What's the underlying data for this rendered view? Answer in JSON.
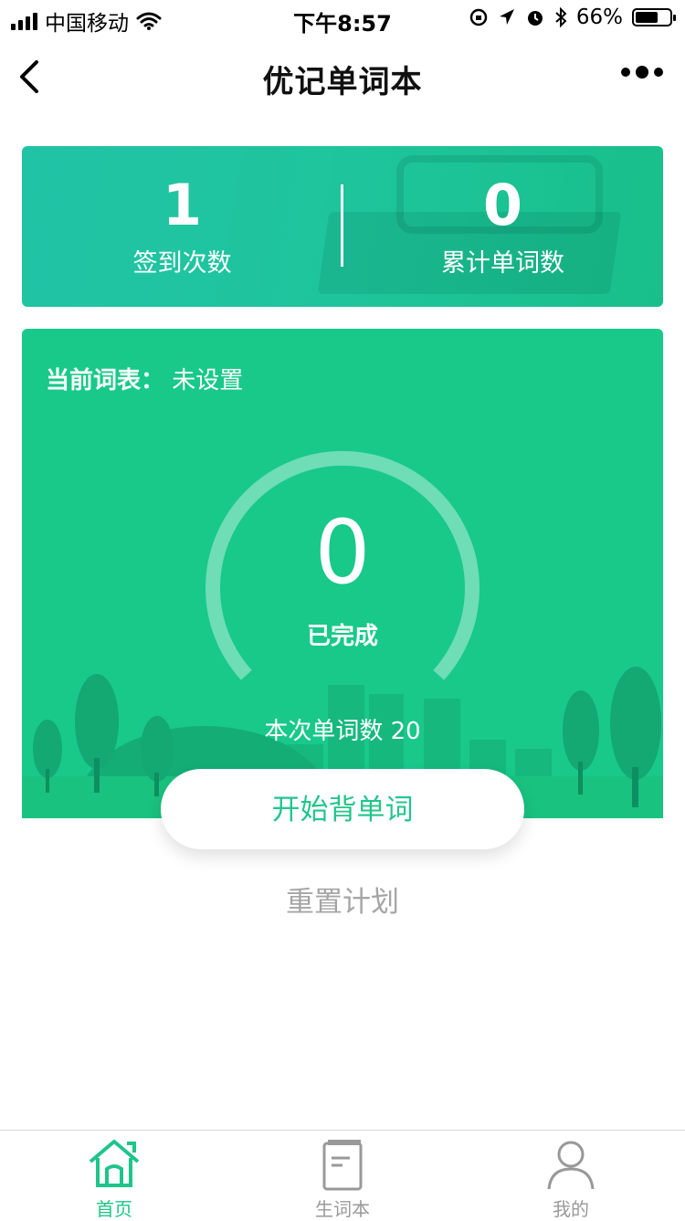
{
  "status_bar": {
    "carrier": "中国移动",
    "time": "下午8:57",
    "battery_text": "66%",
    "battery_level": 0.66
  },
  "nav": {
    "title": "优记单词本",
    "back_icon": "chevron-left-icon",
    "more_icon": "more-dots-icon"
  },
  "stats": {
    "checkin_count": "1",
    "checkin_label": "签到次数",
    "total_words": "0",
    "total_words_label": "累计单词数"
  },
  "plan": {
    "list_label": "当前词表",
    "list_value": "未设置",
    "completed_count": "0",
    "completed_label": "已完成",
    "session_words_label": "本次单词数 20",
    "start_button": "开始背单词",
    "reset_link": "重置计划"
  },
  "tabbar": {
    "items": [
      {
        "label": "首页",
        "icon": "home-icon",
        "active": true
      },
      {
        "label": "生词本",
        "icon": "notebook-icon",
        "active": false
      },
      {
        "label": "我的",
        "icon": "user-icon",
        "active": false
      }
    ]
  },
  "colors": {
    "accent": "#1ec58a",
    "card_green": "#18c98a",
    "stats_teal": "#21c3a6",
    "muted_text": "#a5a5a5"
  }
}
